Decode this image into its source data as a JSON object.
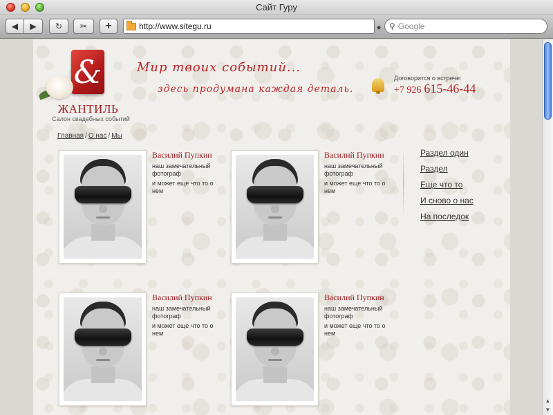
{
  "window": {
    "title": "Сайт Гуру"
  },
  "toolbar": {
    "back_glyph": "◀",
    "forward_glyph": "▶",
    "reload_glyph": "↻",
    "snap_glyph": "✂",
    "add_glyph": "+",
    "address": "http://www.sitegu.ru",
    "search_placeholder": "Google"
  },
  "site": {
    "logo_mark": "&",
    "brand_name": "ЖАНТИЛЬ",
    "brand_subtitle": "Салон свадебных событий",
    "slogan_line1": "Мир твоих событий...",
    "slogan_line2": "здесь продумана каждая деталь.",
    "contact_label": "Договорится о встрече:",
    "phone_prefix": "+7 926",
    "phone_number": "615-46-44"
  },
  "breadcrumb": {
    "items": [
      "Главная",
      "О нас",
      "Мы"
    ],
    "separator": "/"
  },
  "people": [
    {
      "name": "Василий Пупкин",
      "description": "наш замечательный фотограф",
      "extra": "и может еще что то о нем"
    },
    {
      "name": "Василий Пупкин",
      "description": "наш замечательный фотограф",
      "extra": "и может еще что то о нем"
    },
    {
      "name": "Василий Пупкин",
      "description": "наш замечательный фотограф",
      "extra": "и может еще что то о нем"
    },
    {
      "name": "Василий Пупкин",
      "description": "наш замечательный фотограф",
      "extra": "и может еще что то о нем"
    }
  ],
  "side_nav": {
    "items": [
      "Раздел один",
      "Раздел",
      "Еще что то",
      "И сново о нас",
      "На последок"
    ]
  },
  "icons": {
    "close": "close-button-icon",
    "minimize": "minimize-button-icon",
    "maximize": "maximize-button-icon",
    "folder": "folder-icon",
    "search": "magnifier-icon",
    "bell": "bell-icon"
  },
  "colors": {
    "brand_red": "#9b1d22",
    "slogan_red": "#b8252a",
    "scroll_thumb": "#4a7fd8",
    "page_bg": "#f1efeb"
  }
}
